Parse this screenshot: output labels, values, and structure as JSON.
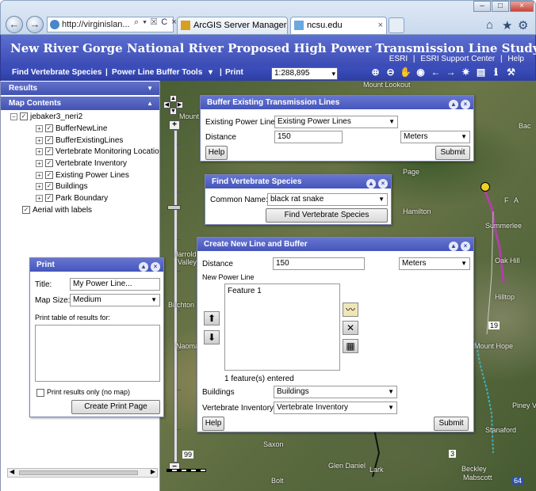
{
  "browser": {
    "address": "http://virginislan...",
    "address_icons": "⌕ ▾ ☒ C ×",
    "tabs": [
      {
        "label": "ArcGIS Server Manager"
      },
      {
        "label": "ncsu.edu"
      }
    ],
    "back_glyph": "←",
    "forward_glyph": "→",
    "home_icon": "⌂",
    "favorites_icon": "★",
    "tools_icon": "⚙",
    "minimize": "–",
    "maximize": "□",
    "close": "×"
  },
  "app": {
    "title": "New River Gorge National River Proposed High Power Transmission Line Study",
    "links": [
      "ESRI",
      "|",
      "ESRI Support Center",
      "|",
      "Help"
    ]
  },
  "toolbar": {
    "find_species": "Find Vertebrate Species",
    "sep1": "|",
    "buffer_tools": "Power Line Buffer Tools",
    "buffer_arrow": "▾",
    "sep2": "|",
    "print": "Print",
    "scale": "1:288,895",
    "icons": [
      "⊕",
      "⊖",
      "✋",
      "◉",
      "←",
      "→",
      "✷",
      "▤",
      "ℹ",
      "⚒"
    ]
  },
  "left": {
    "results_header": "Results",
    "contents_header": "Map Contents",
    "root": "jebaker3_neri2",
    "layers": [
      "BufferNewLine",
      "BufferExistingLines",
      "Vertebrate Monitoring Locatio",
      "Vertebrate Inventory",
      "Existing Power Lines",
      "Buildings",
      "Park Boundary"
    ],
    "basemap": "Aerial with labels"
  },
  "map_labels": [
    "Mount",
    "Jarrolds",
    "Valley",
    "Birchton",
    "Naoma",
    "Saxon",
    "Glen Daniel",
    "Bolt",
    "Hamilton",
    "Page",
    "Summerlee",
    "Oak Hill",
    "Hilltop",
    "Mount Hope",
    "Piney V",
    "Stanaford",
    "Beckley",
    "Mabscott",
    "99",
    "19",
    "3",
    "64",
    "Mount Lookout",
    "Bac",
    "F",
    "A",
    "Lark"
  ],
  "buffer_existing": {
    "title": "Buffer Existing Transmission Lines",
    "existing_label": "Existing Power Lines",
    "existing_value": "Existing Power Lines",
    "distance_label": "Distance",
    "distance_value": "150",
    "units_value": "Meters",
    "help": "Help",
    "submit": "Submit"
  },
  "find_species": {
    "title": "Find Vertebrate Species",
    "common_label": "Common Name:",
    "common_value": "black rat snake",
    "button": "Find Vertebrate Species"
  },
  "create_line": {
    "title": "Create New Line and Buffer",
    "distance_label": "Distance",
    "distance_value": "150",
    "units_value": "Meters",
    "new_line_label": "New Power Line",
    "feature": "Feature 1",
    "count": "1 feature(s) entered",
    "buildings_label": "Buildings",
    "buildings_value": "Buildings",
    "veg_label": "Vertebrate Inventory",
    "veg_value": "Vertebrate Inventory",
    "help": "Help",
    "submit": "Submit"
  },
  "print": {
    "title": "Print",
    "title_label": "Title:",
    "title_value": "My Power Line...",
    "size_label": "Map Size:",
    "size_value": "Medium",
    "table_label": "Print table of results for:",
    "only_label": "Print results only (no map)",
    "button": "Create Print Page"
  },
  "colors": {
    "header": "#4a5ac4",
    "panel_head": "#5060c0",
    "transmission_line": "#b040a8"
  }
}
